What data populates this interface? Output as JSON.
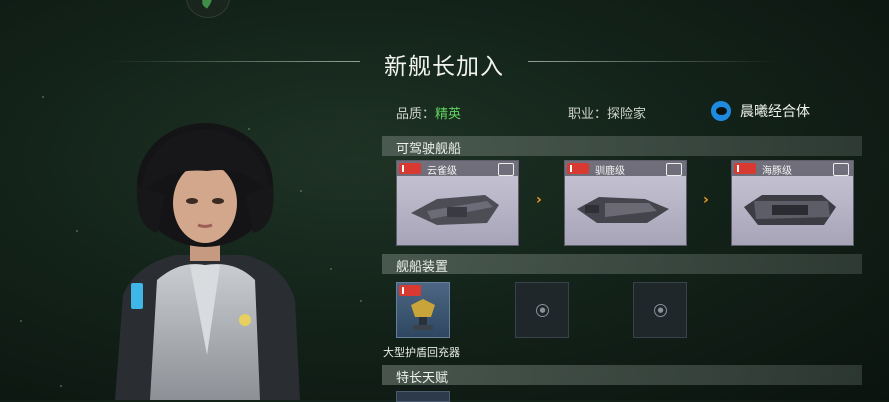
{
  "header": {
    "title": "新舰长加入"
  },
  "captain": {
    "quality_label": "品质：",
    "quality_value": "精英",
    "job_label": "职业：",
    "job_value": "探险家",
    "faction": "晨曦经合体"
  },
  "sections": {
    "ships": "可驾驶舰船",
    "equipment": "舰船装置",
    "talents": "特长天赋"
  },
  "ships": [
    {
      "name": "云雀级"
    },
    {
      "name": "驯鹿级"
    },
    {
      "name": "海豚级"
    }
  ],
  "equipment": {
    "item_name": "大型护盾回充器"
  },
  "colors": {
    "quality": "#5fd35f",
    "faction": "#1f8be0",
    "arrow": "#f0a020",
    "rank": "#d83a32"
  },
  "icons": [
    "faction-icon",
    "rank-badge-icon",
    "arrow-right-icon",
    "lock-icon",
    "shield-device-icon"
  ]
}
